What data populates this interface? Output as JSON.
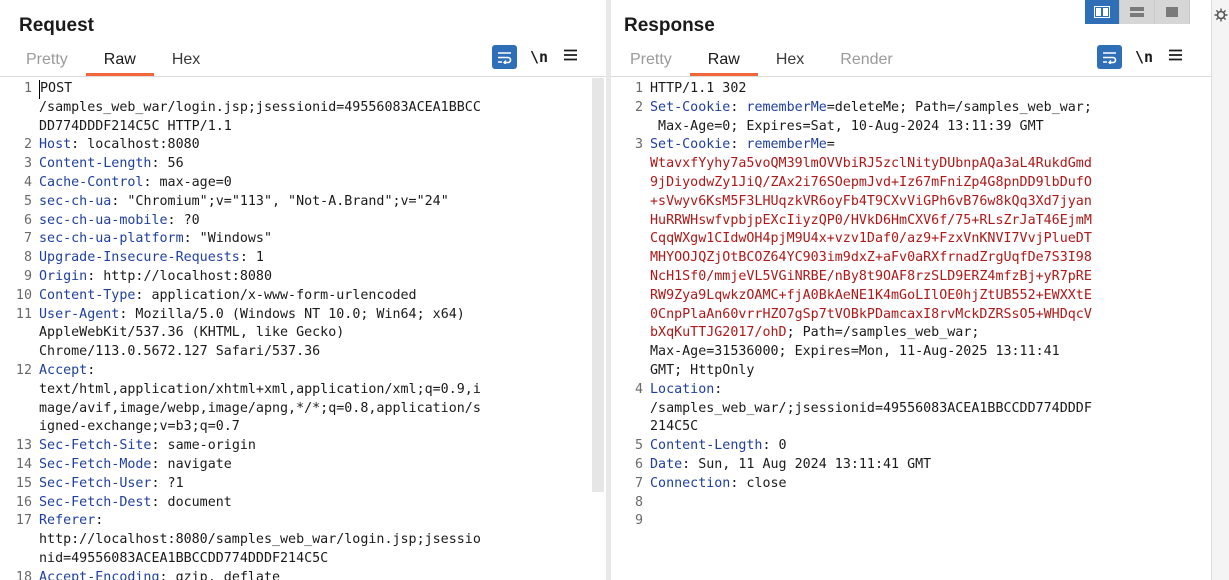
{
  "request": {
    "title": "Request",
    "tabs": [
      "Pretty",
      "Raw",
      "Hex"
    ],
    "newline_label": "\\n",
    "lines": [
      {
        "n": "1",
        "segs": [
          {
            "t": "POST",
            "c": "code"
          }
        ]
      },
      {
        "n": "",
        "segs": [
          {
            "t": "/samples_web_war/login.jsp;jsessionid=49556083ACEA1BBCC",
            "c": "code"
          }
        ]
      },
      {
        "n": "",
        "segs": [
          {
            "t": "DD774DDDF214C5C HTTP/1.1",
            "c": "code"
          }
        ]
      },
      {
        "n": "2",
        "segs": [
          {
            "t": "Host",
            "c": "hn"
          },
          {
            "t": ": localhost:8080",
            "c": "code"
          }
        ]
      },
      {
        "n": "3",
        "segs": [
          {
            "t": "Content-Length",
            "c": "hn"
          },
          {
            "t": ": 56",
            "c": "code"
          }
        ]
      },
      {
        "n": "4",
        "segs": [
          {
            "t": "Cache-Control",
            "c": "hn"
          },
          {
            "t": ": max-age=0",
            "c": "code"
          }
        ]
      },
      {
        "n": "5",
        "segs": [
          {
            "t": "sec-ch-ua",
            "c": "hn"
          },
          {
            "t": ": \"Chromium\";v=\"113\", \"Not-A.Brand\";v=\"24\"",
            "c": "code"
          }
        ]
      },
      {
        "n": "6",
        "segs": [
          {
            "t": "sec-ch-ua-mobile",
            "c": "hn"
          },
          {
            "t": ": ?0",
            "c": "code"
          }
        ]
      },
      {
        "n": "7",
        "segs": [
          {
            "t": "sec-ch-ua-platform",
            "c": "hn"
          },
          {
            "t": ": \"Windows\"",
            "c": "code"
          }
        ]
      },
      {
        "n": "8",
        "segs": [
          {
            "t": "Upgrade-Insecure-Requests",
            "c": "hn"
          },
          {
            "t": ": 1",
            "c": "code"
          }
        ]
      },
      {
        "n": "9",
        "segs": [
          {
            "t": "Origin",
            "c": "hn"
          },
          {
            "t": ": http://localhost:8080",
            "c": "code"
          }
        ]
      },
      {
        "n": "10",
        "segs": [
          {
            "t": "Content-Type",
            "c": "hn"
          },
          {
            "t": ": application/x-www-form-urlencoded",
            "c": "code"
          }
        ]
      },
      {
        "n": "11",
        "segs": [
          {
            "t": "User-Agent",
            "c": "hn"
          },
          {
            "t": ": Mozilla/5.0 (Windows NT 10.0; Win64; x64)",
            "c": "code"
          }
        ]
      },
      {
        "n": "",
        "segs": [
          {
            "t": "AppleWebKit/537.36 (KHTML, like Gecko)",
            "c": "code"
          }
        ]
      },
      {
        "n": "",
        "segs": [
          {
            "t": "Chrome/113.0.5672.127 Safari/537.36",
            "c": "code"
          }
        ]
      },
      {
        "n": "12",
        "segs": [
          {
            "t": "Accept",
            "c": "hn"
          },
          {
            "t": ":",
            "c": "code"
          }
        ]
      },
      {
        "n": "",
        "segs": [
          {
            "t": "text/html,application/xhtml+xml,application/xml;q=0.9,i",
            "c": "code"
          }
        ]
      },
      {
        "n": "",
        "segs": [
          {
            "t": "mage/avif,image/webp,image/apng,*/*;q=0.8,application/s",
            "c": "code"
          }
        ]
      },
      {
        "n": "",
        "segs": [
          {
            "t": "igned-exchange;v=b3;q=0.7",
            "c": "code"
          }
        ]
      },
      {
        "n": "13",
        "segs": [
          {
            "t": "Sec-Fetch-Site",
            "c": "hn"
          },
          {
            "t": ": same-origin",
            "c": "code"
          }
        ]
      },
      {
        "n": "14",
        "segs": [
          {
            "t": "Sec-Fetch-Mode",
            "c": "hn"
          },
          {
            "t": ": navigate",
            "c": "code"
          }
        ]
      },
      {
        "n": "15",
        "segs": [
          {
            "t": "Sec-Fetch-User",
            "c": "hn"
          },
          {
            "t": ": ?1",
            "c": "code"
          }
        ]
      },
      {
        "n": "16",
        "segs": [
          {
            "t": "Sec-Fetch-Dest",
            "c": "hn"
          },
          {
            "t": ": document",
            "c": "code"
          }
        ]
      },
      {
        "n": "17",
        "segs": [
          {
            "t": "Referer",
            "c": "hn"
          },
          {
            "t": ":",
            "c": "code"
          }
        ]
      },
      {
        "n": "",
        "segs": [
          {
            "t": "http://localhost:8080/samples_web_war/login.jsp;jsessio",
            "c": "code"
          }
        ]
      },
      {
        "n": "",
        "segs": [
          {
            "t": "nid=49556083ACEA1BBCCDD774DDDF214C5C",
            "c": "code"
          }
        ]
      },
      {
        "n": "18",
        "segs": [
          {
            "t": "Accept-Encoding",
            "c": "hn"
          },
          {
            "t": ": gzip, deflate",
            "c": "code"
          }
        ]
      }
    ]
  },
  "response": {
    "title": "Response",
    "tabs": [
      "Pretty",
      "Raw",
      "Hex",
      "Render"
    ],
    "newline_label": "\\n",
    "lines": [
      {
        "n": "1",
        "segs": [
          {
            "t": "HTTP/1.1 302",
            "c": "code"
          }
        ]
      },
      {
        "n": "2",
        "segs": [
          {
            "t": "Set-Cookie",
            "c": "hn"
          },
          {
            "t": ": ",
            "c": "code"
          },
          {
            "t": "rememberMe",
            "c": "hn"
          },
          {
            "t": "=deleteMe; Path=/samples_web_war;",
            "c": "code"
          }
        ]
      },
      {
        "n": "",
        "segs": [
          {
            "t": " Max-Age=0; Expires=Sat, 10-Aug-2024 13:11:39 GMT",
            "c": "code"
          }
        ]
      },
      {
        "n": "3",
        "segs": [
          {
            "t": "Set-Cookie",
            "c": "hn"
          },
          {
            "t": ": ",
            "c": "code"
          },
          {
            "t": "rememberMe",
            "c": "hn"
          },
          {
            "t": "=",
            "c": "code"
          }
        ]
      },
      {
        "n": "",
        "segs": [
          {
            "t": "WtavxfYyhy7a5voQM39lmOVVbiRJ5zclNityDUbnpAQa3aL4RukdGmd",
            "c": "red"
          }
        ]
      },
      {
        "n": "",
        "segs": [
          {
            "t": "9jDiyodwZy1JiQ/ZAx2i76SOepmJvd+Iz67mFniZp4G8pnDD9lbDufO",
            "c": "red"
          }
        ]
      },
      {
        "n": "",
        "segs": [
          {
            "t": "+sVwyv6KsM5F3LHUqzkVR6oyFb4T9CXvViGPh6vB76w8kQq3Xd7jyan",
            "c": "red"
          }
        ]
      },
      {
        "n": "",
        "segs": [
          {
            "t": "HuRRWHswfvpbjpEXcIiyzQP0/HVkD6HmCXV6f/75+RLsZrJaT46EjmM",
            "c": "red"
          }
        ]
      },
      {
        "n": "",
        "segs": [
          {
            "t": "CqqWXgw1CIdwOH4pjM9U4x+vzv1Daf0/az9+FzxVnKNVI7VvjPlueDT",
            "c": "red"
          }
        ]
      },
      {
        "n": "",
        "segs": [
          {
            "t": "MHYOOJQZjOtBCOZ64YC903im9dxZ+aFv0aRXfrnadZrgUqfDe7S3I98",
            "c": "red"
          }
        ]
      },
      {
        "n": "",
        "segs": [
          {
            "t": "NcH1Sf0/mmjeVL5VGiNRBE/nBy8t9OAF8rzSLD9ERZ4mfzBj+yR7pRE",
            "c": "red"
          }
        ]
      },
      {
        "n": "",
        "segs": [
          {
            "t": "RW9Zya9LqwkzOAMC+fjA0BkAeNE1K4mGoLIlOE0hjZtUB552+EWXXtE",
            "c": "red"
          }
        ]
      },
      {
        "n": "",
        "segs": [
          {
            "t": "0CnpPlaAn60vrrHZO7gSp7tVOBkPDamcaxI8rvMckDZRSsO5+WHDqcV",
            "c": "red"
          }
        ]
      },
      {
        "n": "",
        "segs": [
          {
            "t": "bXqKuTTJG2017/ohD",
            "c": "red"
          },
          {
            "t": "; Path=/samples_web_war;",
            "c": "code"
          }
        ]
      },
      {
        "n": "",
        "segs": [
          {
            "t": "Max-Age=31536000; Expires=Mon, 11-Aug-2025 13:11:41",
            "c": "code"
          }
        ]
      },
      {
        "n": "",
        "segs": [
          {
            "t": "GMT; HttpOnly",
            "c": "code"
          }
        ]
      },
      {
        "n": "4",
        "segs": [
          {
            "t": "Location",
            "c": "hn"
          },
          {
            "t": ":",
            "c": "code"
          }
        ]
      },
      {
        "n": "",
        "segs": [
          {
            "t": "/samples_web_war/;jsessionid=49556083ACEA1BBCCDD774DDDF",
            "c": "code"
          }
        ]
      },
      {
        "n": "",
        "segs": [
          {
            "t": "214C5C",
            "c": "code"
          }
        ]
      },
      {
        "n": "5",
        "segs": [
          {
            "t": "Content-Length",
            "c": "hn"
          },
          {
            "t": ": 0",
            "c": "code"
          }
        ]
      },
      {
        "n": "6",
        "segs": [
          {
            "t": "Date",
            "c": "hn"
          },
          {
            "t": ": Sun, 11 Aug 2024 13:11:41 GMT",
            "c": "code"
          }
        ]
      },
      {
        "n": "7",
        "segs": [
          {
            "t": "Connection",
            "c": "hn"
          },
          {
            "t": ": close",
            "c": "code"
          }
        ]
      },
      {
        "n": "8",
        "segs": []
      },
      {
        "n": "9",
        "segs": []
      }
    ]
  },
  "colors": {
    "accent_underline": "#f2673a",
    "header_name": "#1f3fa0",
    "cookie_value": "#b01818",
    "button_blue": "#2f6fb7"
  }
}
